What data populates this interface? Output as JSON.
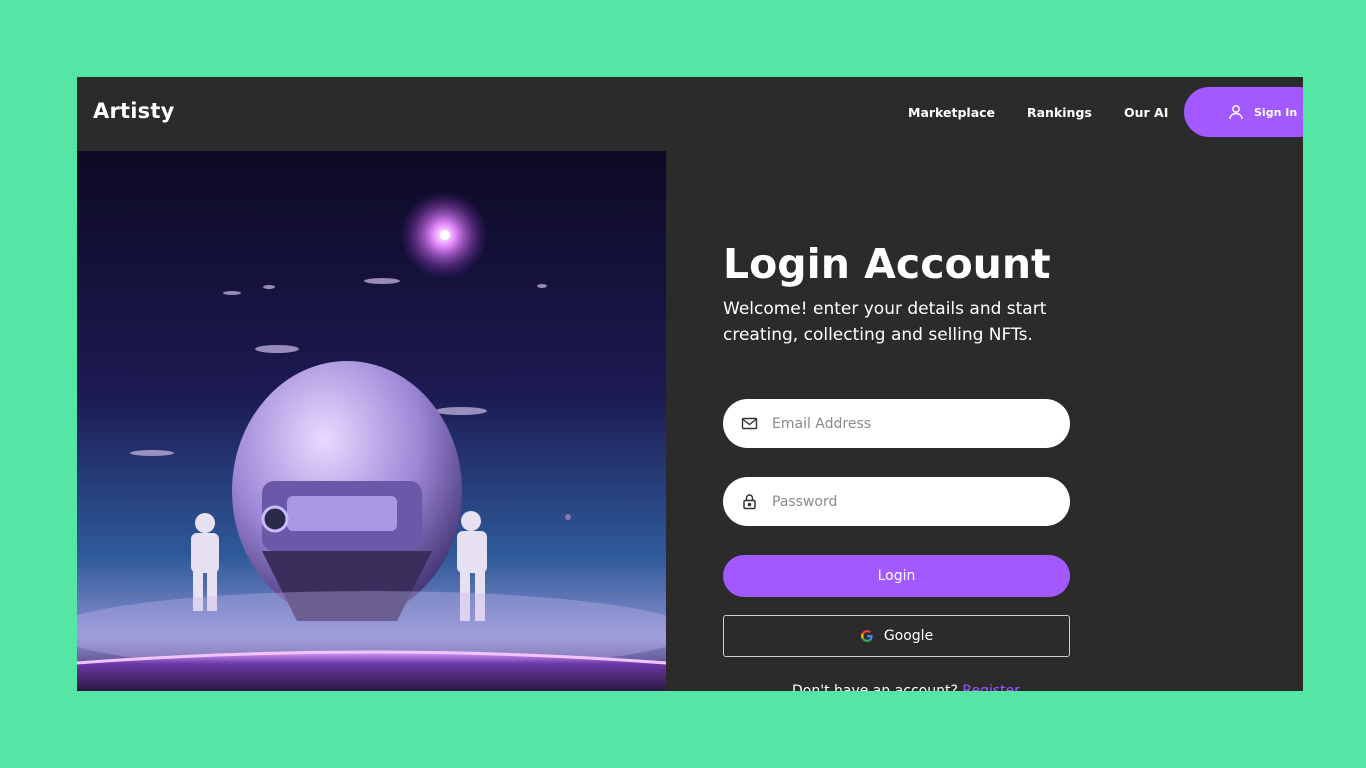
{
  "nav": {
    "logo": "Artisty",
    "links": [
      "Marketplace",
      "Rankings",
      "Our AI"
    ],
    "signin_label": "Sign In"
  },
  "hero": {
    "image": "astronauts-and-spaceship-artwork"
  },
  "form": {
    "title": "Login Account",
    "subtitle": "Welcome! enter your details and start creating, collecting and selling NFTs.",
    "email_placeholder": "Email Address",
    "password_placeholder": "Password",
    "login_label": "Login",
    "google_label": "Google",
    "footer_text": "Don't have an account?",
    "footer_link": "Register"
  },
  "colors": {
    "background": "#55e6a5",
    "panel": "#2b2b2b",
    "accent": "#a259ff"
  },
  "icons": {
    "signin": "user-icon",
    "email": "mail-icon",
    "password": "lock-icon",
    "google": "google-icon"
  }
}
